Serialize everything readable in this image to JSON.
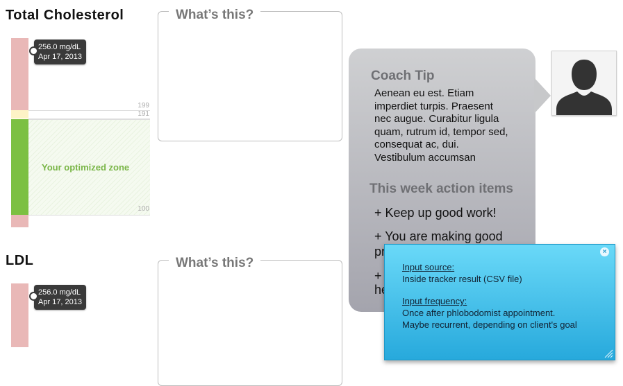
{
  "total_cholesterol": {
    "title": "Total Cholesterol",
    "tooltip_value": "256.0 mg/dL",
    "tooltip_date": "Apr 17, 2013",
    "ticks": [
      "199",
      "191",
      "100"
    ],
    "zone_label": "Your optimized zone",
    "colors": {
      "high": "#e9b8b7",
      "border": "#fdf3c6",
      "optimal": "#7cc042"
    }
  },
  "ldl": {
    "title": "LDL",
    "tooltip_value": "256.0 mg/dL",
    "tooltip_date": "Apr 17, 2013"
  },
  "whats_this": {
    "label": "What’s this?"
  },
  "coach": {
    "title": "Coach Tip",
    "tip_lines": [
      "Aenean eu est. Etiam",
      "imperdiet turpis. Praesent",
      "nec augue. Curabitur ligula",
      "quam, rutrum id, tempor sed,",
      "consequat ac, dui.",
      "Vestibulum accumsan"
    ],
    "actions_title": "This week action items",
    "actions": [
      "+ Keep up good work!",
      "+ You are making good",
      "pr",
      "+",
      "he"
    ]
  },
  "note": {
    "source_label": "Input source:",
    "source_value": "Inside tracker result (CSV file)",
    "frequency_label": "Input frequency:",
    "frequency_lines": [
      "Once after phlobodomist appointment.",
      "Maybe recurrent, depending on client's goal"
    ],
    "close_icon": "×"
  },
  "icons": {
    "avatar": "person-silhouette-icon",
    "close": "close-icon",
    "resize": "resize-grip-icon"
  }
}
